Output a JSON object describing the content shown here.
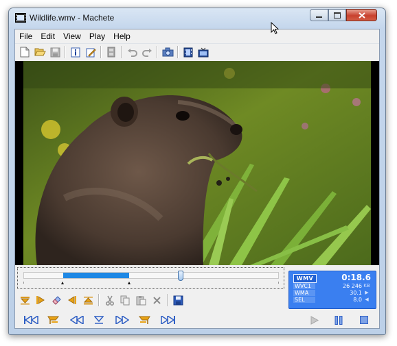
{
  "window": {
    "title": "Wildlife.wmv - Machete"
  },
  "menu": [
    {
      "label": "File"
    },
    {
      "label": "Edit"
    },
    {
      "label": "View"
    },
    {
      "label": "Play"
    },
    {
      "label": "Help"
    }
  ],
  "toolbar_icons": [
    "new-file-icon",
    "open-folder-icon",
    "save-icon",
    "info-icon",
    "edit-tags-icon",
    "film-strip-icon",
    "undo-icon",
    "redo-icon",
    "snapshot-camera-icon",
    "export-frames-icon",
    "tv-output-icon"
  ],
  "seek": {
    "selection_start": 0.155,
    "selection_end": 0.415,
    "position": 0.615
  },
  "info_panel": {
    "format": "WMV",
    "time": "0:18.6",
    "rows": [
      {
        "label": "WVC1",
        "value": "26 246",
        "unit": "KB"
      },
      {
        "label": "WMA",
        "value": "30.1",
        "unit": "▶"
      },
      {
        "label": "SEL",
        "value": "8.0",
        "unit": "◀"
      }
    ]
  },
  "colors": {
    "accent": "#3a7ff0",
    "selection": "#1e88e5",
    "marker_orange": "#e8a317",
    "transport_blue": "#2f5fc4"
  }
}
